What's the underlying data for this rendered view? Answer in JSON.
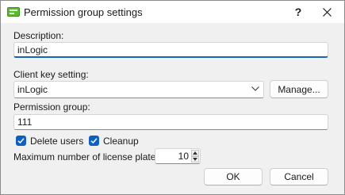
{
  "window": {
    "title": "Permission group settings",
    "help_label": "?"
  },
  "description": {
    "label": "Description:",
    "value": "inLogic"
  },
  "client_key": {
    "label": "Client key setting:",
    "selected": "inLogic",
    "manage_label": "Manage..."
  },
  "permission_group": {
    "label": "Permission group:",
    "value": "111"
  },
  "options": {
    "delete_users": {
      "label": "Delete users",
      "checked": true
    },
    "cleanup": {
      "label": "Cleanup",
      "checked": true
    }
  },
  "license_plates": {
    "label": "Maximum number of license plates:",
    "value": "10"
  },
  "buttons": {
    "ok_label": "OK",
    "cancel_label": "Cancel"
  },
  "colors": {
    "accent": "#0f5fc2",
    "app_icon": "#5cb82e"
  },
  "icons": {
    "app": "app-icon",
    "close": "close-icon",
    "dropdown": "chevron-down-icon",
    "check": "checkmark-icon",
    "spin_up": "spin-up-icon",
    "spin_down": "spin-down-icon"
  }
}
